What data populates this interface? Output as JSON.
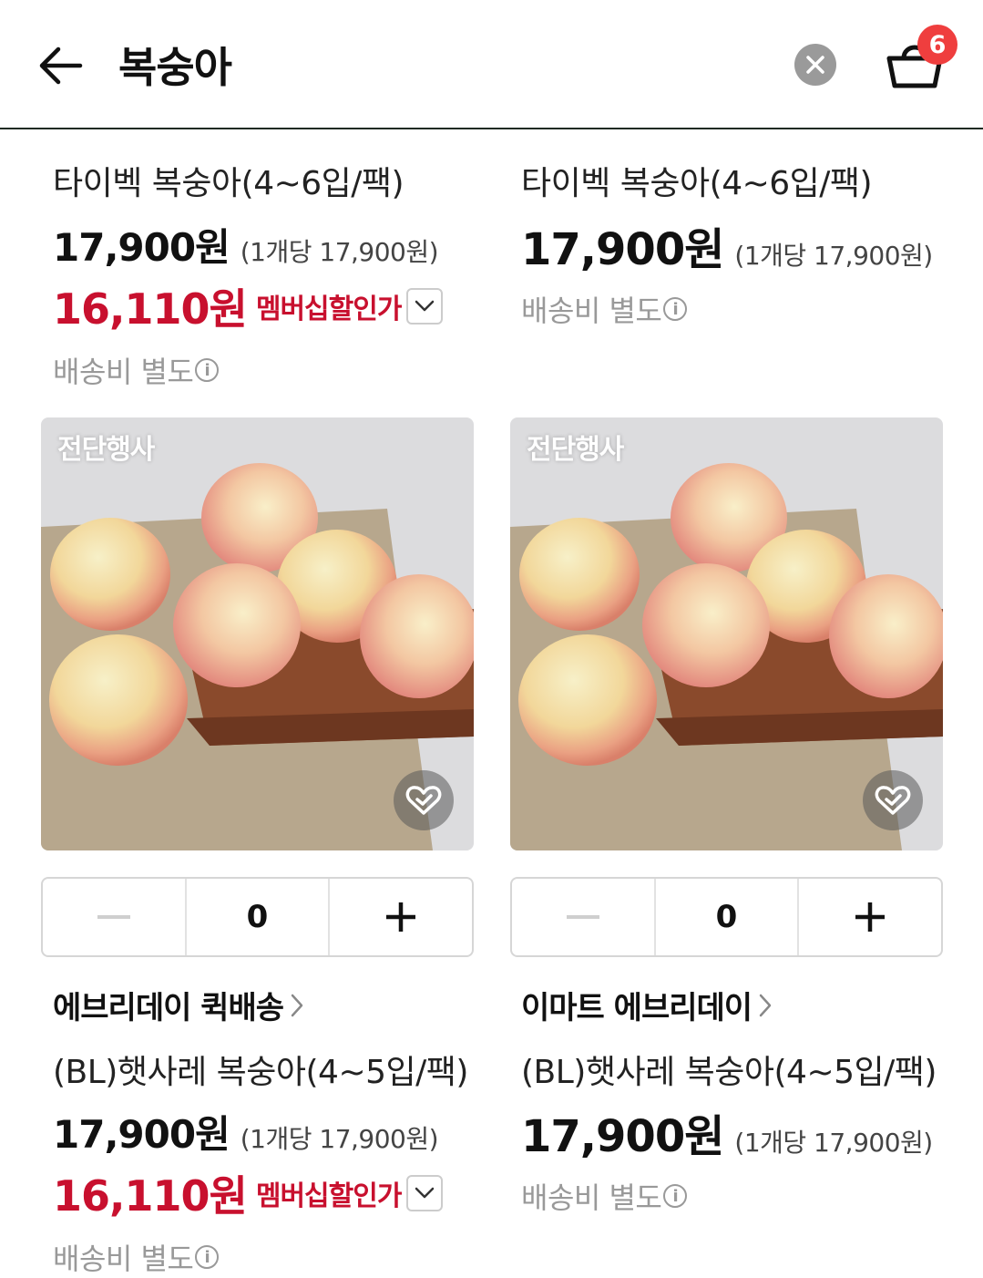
{
  "header": {
    "title": "복숭아",
    "cart_count": "6"
  },
  "top_row": {
    "left": {
      "product_name": "타이벡 복숭아(4~6입/팩)",
      "price": "17,900원",
      "unit_price": "(1개당 17,900원)",
      "member_price": "16,110원",
      "member_label": "멤버십할인가",
      "shipping": "배송비 별도"
    },
    "right": {
      "product_name": "타이벡 복숭아(4~6입/팩)",
      "price": "17,900원",
      "unit_price": "(1개당 17,900원)",
      "shipping": "배송비 별도"
    }
  },
  "bottom_row": {
    "left": {
      "event_tag": "전단행사",
      "quantity": "0",
      "seller": "에브리데이 퀵배송",
      "product_name": "(BL)햇사레 복숭아(4~5입/팩)",
      "price": "17,900원",
      "unit_price": "(1개당 17,900원)",
      "member_price": "16,110원",
      "member_label": "멤버십할인가",
      "shipping": "배송비 별도"
    },
    "right": {
      "event_tag": "전단행사",
      "quantity": "0",
      "seller": "이마트 에브리데이",
      "product_name": "(BL)햇사레 복숭아(4~5입/팩)",
      "price": "17,900원",
      "unit_price": "(1개당 17,900원)",
      "shipping": "배송비 별도"
    }
  },
  "colors": {
    "accent_red": "#c8102e",
    "badge_red": "#ef3e3e",
    "muted_gray": "#999999"
  },
  "icons": [
    "back-arrow-icon",
    "clear-icon",
    "cart-icon",
    "chevron-down-icon",
    "info-icon",
    "chevron-right-icon",
    "wish-heart-icon",
    "minus-icon",
    "plus-icon"
  ]
}
